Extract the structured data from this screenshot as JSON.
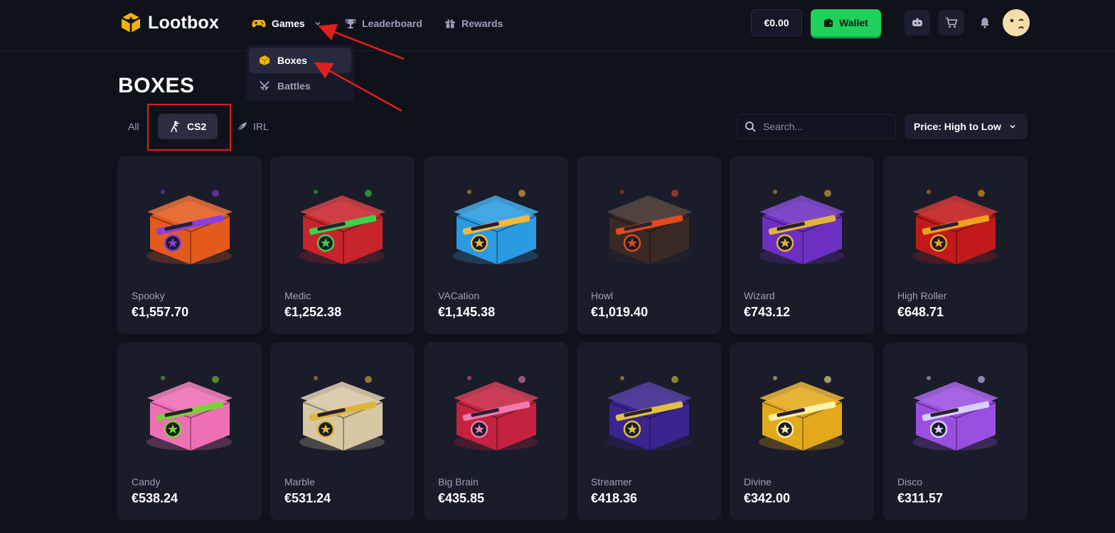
{
  "header": {
    "brand": "Lootbox",
    "nav": [
      {
        "label": "Games",
        "icon": "gamepad-icon",
        "active": true
      },
      {
        "label": "Leaderboard",
        "icon": "trophy-icon"
      },
      {
        "label": "Rewards",
        "icon": "gift-icon"
      }
    ],
    "balance": "€0.00",
    "wallet_label": "Wallet"
  },
  "games_menu": {
    "items": [
      {
        "label": "Boxes",
        "icon": "box-icon",
        "active": true
      },
      {
        "label": "Battles",
        "icon": "crossed-swords-icon"
      }
    ]
  },
  "page": {
    "title": "BOXES",
    "filters": [
      {
        "label": "All"
      },
      {
        "label": "CS2",
        "selected": true,
        "icon": "cs2-soldier-icon"
      },
      {
        "label": "IRL",
        "icon": "feather-icon"
      }
    ],
    "search_placeholder": "Search...",
    "sort_label": "Price: High to Low"
  },
  "boxes": [
    {
      "name": "Spooky",
      "price": "€1,557.70",
      "color": "#e35a1c",
      "accent": "#8a3ee0"
    },
    {
      "name": "Medic",
      "price": "€1,252.38",
      "color": "#c8242b",
      "accent": "#3ed04a"
    },
    {
      "name": "VACation",
      "price": "€1,145.38",
      "color": "#2a9be0",
      "accent": "#f5b73c"
    },
    {
      "name": "Howl",
      "price": "€1,019.40",
      "color": "#3a2a26",
      "accent": "#e04a1c"
    },
    {
      "name": "Wizard",
      "price": "€743.12",
      "color": "#6d2fc2",
      "accent": "#e0b43c"
    },
    {
      "name": "High Roller",
      "price": "€648.71",
      "color": "#c21a1a",
      "accent": "#f0a020"
    },
    {
      "name": "Candy",
      "price": "€538.24",
      "color": "#ef6fb5",
      "accent": "#7ad13a"
    },
    {
      "name": "Marble",
      "price": "€531.24",
      "color": "#d8c7a3",
      "accent": "#e0b43c"
    },
    {
      "name": "Big Brain",
      "price": "€435.85",
      "color": "#c4233f",
      "accent": "#f07ab0"
    },
    {
      "name": "Streamer",
      "price": "€418.36",
      "color": "#3a248e",
      "accent": "#e0c040"
    },
    {
      "name": "Divine",
      "price": "€342.00",
      "color": "#e3a91c",
      "accent": "#fff1a8"
    },
    {
      "name": "Disco",
      "price": "€311.57",
      "color": "#9a4fe0",
      "accent": "#d6d0ff"
    }
  ]
}
